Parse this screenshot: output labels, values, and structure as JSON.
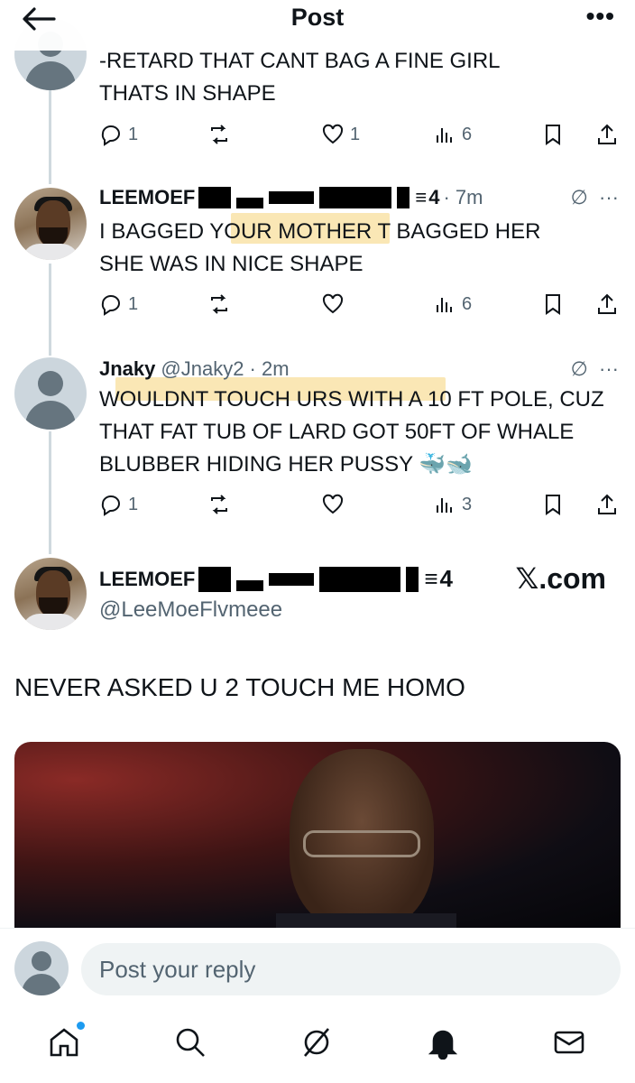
{
  "header": {
    "title": "Post"
  },
  "tweets": [
    {
      "text": "-RETARD THAT CANT BAG A FINE GIRL THATS IN SHAPE",
      "stats": {
        "replies": "1",
        "reposts": "",
        "likes": "1",
        "views": "6"
      }
    },
    {
      "name": "LEEMOEF",
      "tier": "4",
      "time": "· 7m",
      "text": "I BAGGED YOUR MOTHER T BAGGED HER SHE WAS IN NICE SHAPE",
      "stats": {
        "replies": "1",
        "reposts": "",
        "likes": "",
        "views": "6"
      }
    },
    {
      "name": "Jnaky",
      "handle": "@Jnaky2 · 2m",
      "text": "WOULDNT TOUCH URS WITH A 10 FT POLE, CUZ THAT FAT TUB OF LARD GOT 50FT OF WHALE BLUBBER HIDING HER PUSSY 🐳🐋",
      "stats": {
        "replies": "1",
        "reposts": "",
        "likes": "",
        "views": "3"
      }
    }
  ],
  "main_post": {
    "name": "LEEMOEF",
    "tier": "4",
    "handle": "@LeeMoeFlvmeee",
    "text": "NEVER ASKED U 2 TOUCH ME HOMO",
    "watermark": "𝕏.com"
  },
  "reply_bar": {
    "placeholder": "Post your reply"
  },
  "nav": {
    "items": [
      "home-icon",
      "search-icon",
      "grok-icon",
      "notifications-icon",
      "messages-icon"
    ],
    "notification_dot_color": "#1d9bf0"
  },
  "colors": {
    "text": "#0f1419",
    "secondary": "#536471",
    "accent": "#1d9bf0",
    "highlight": "#f5d478"
  }
}
